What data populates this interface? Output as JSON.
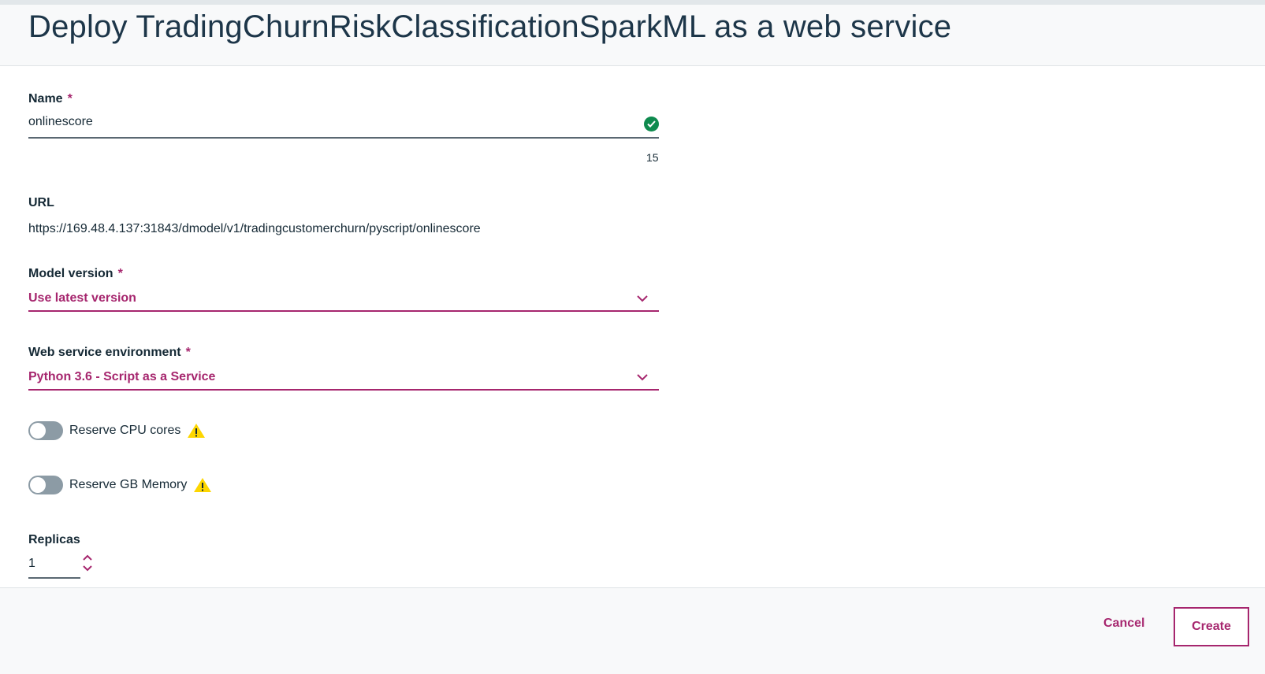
{
  "header": {
    "title_prefix": "Deploy",
    "model_name": "TradingChurnRiskClassificationSparkML",
    "title_suffix": "as a web service"
  },
  "form": {
    "name": {
      "label": "Name",
      "required_mark": "*",
      "value": "onlinescore",
      "char_count": "15",
      "status_icon": "check-circle-icon"
    },
    "url": {
      "label": "URL",
      "value": "https://169.48.4.137:31843/dmodel/v1/tradingcustomerchurn/pyscript/onlinescore"
    },
    "model_version": {
      "label": "Model version",
      "required_mark": "*",
      "selected": "Use latest version"
    },
    "environment": {
      "label": "Web service environment",
      "required_mark": "*",
      "selected": "Python 3.6 - Script as a Service"
    },
    "reserve_cpu": {
      "label": "Reserve CPU cores",
      "enabled": false,
      "icon": "warning-icon"
    },
    "reserve_memory": {
      "label": "Reserve GB Memory",
      "enabled": false,
      "icon": "warning-icon"
    },
    "replicas": {
      "label": "Replicas",
      "value": "1"
    }
  },
  "footer": {
    "cancel_label": "Cancel",
    "create_label": "Create"
  },
  "colors": {
    "accent": "#a6266e",
    "success": "#0e8a4e",
    "warning": "#fdd600",
    "text": "#152935"
  }
}
